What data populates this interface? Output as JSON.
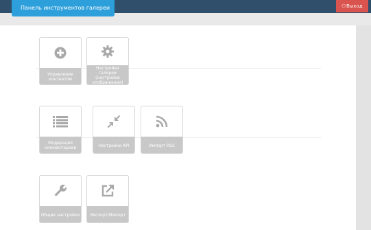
{
  "header": {
    "title": "Панель инструментов галереи",
    "logout_label": "Выход",
    "logout_icon": "power-icon"
  },
  "colors": {
    "topbar": "#2f4f6b",
    "tab_accent": "#2d9fdb",
    "logout": "#d9534f",
    "tile_label_bg": "#c8c8c8",
    "icon_gray": "#a9a9a9"
  },
  "tiles": [
    {
      "label": "Управление\nконтентом",
      "icon": "plus-circle-icon"
    },
    {
      "label": "Настройки галереи\n(настройки\nотображения)",
      "icon": "gear-icon"
    },
    {
      "label": "Модерация\nкомментариев",
      "icon": "list-icon"
    },
    {
      "label": "Настройки API",
      "icon": "compress-arrows-icon"
    },
    {
      "label": "Импорт RSS",
      "icon": "rss-icon"
    },
    {
      "label": "Общие настройки",
      "icon": "wrench-icon"
    },
    {
      "label": "Экспорт/Импорт",
      "icon": "external-link-icon"
    }
  ]
}
